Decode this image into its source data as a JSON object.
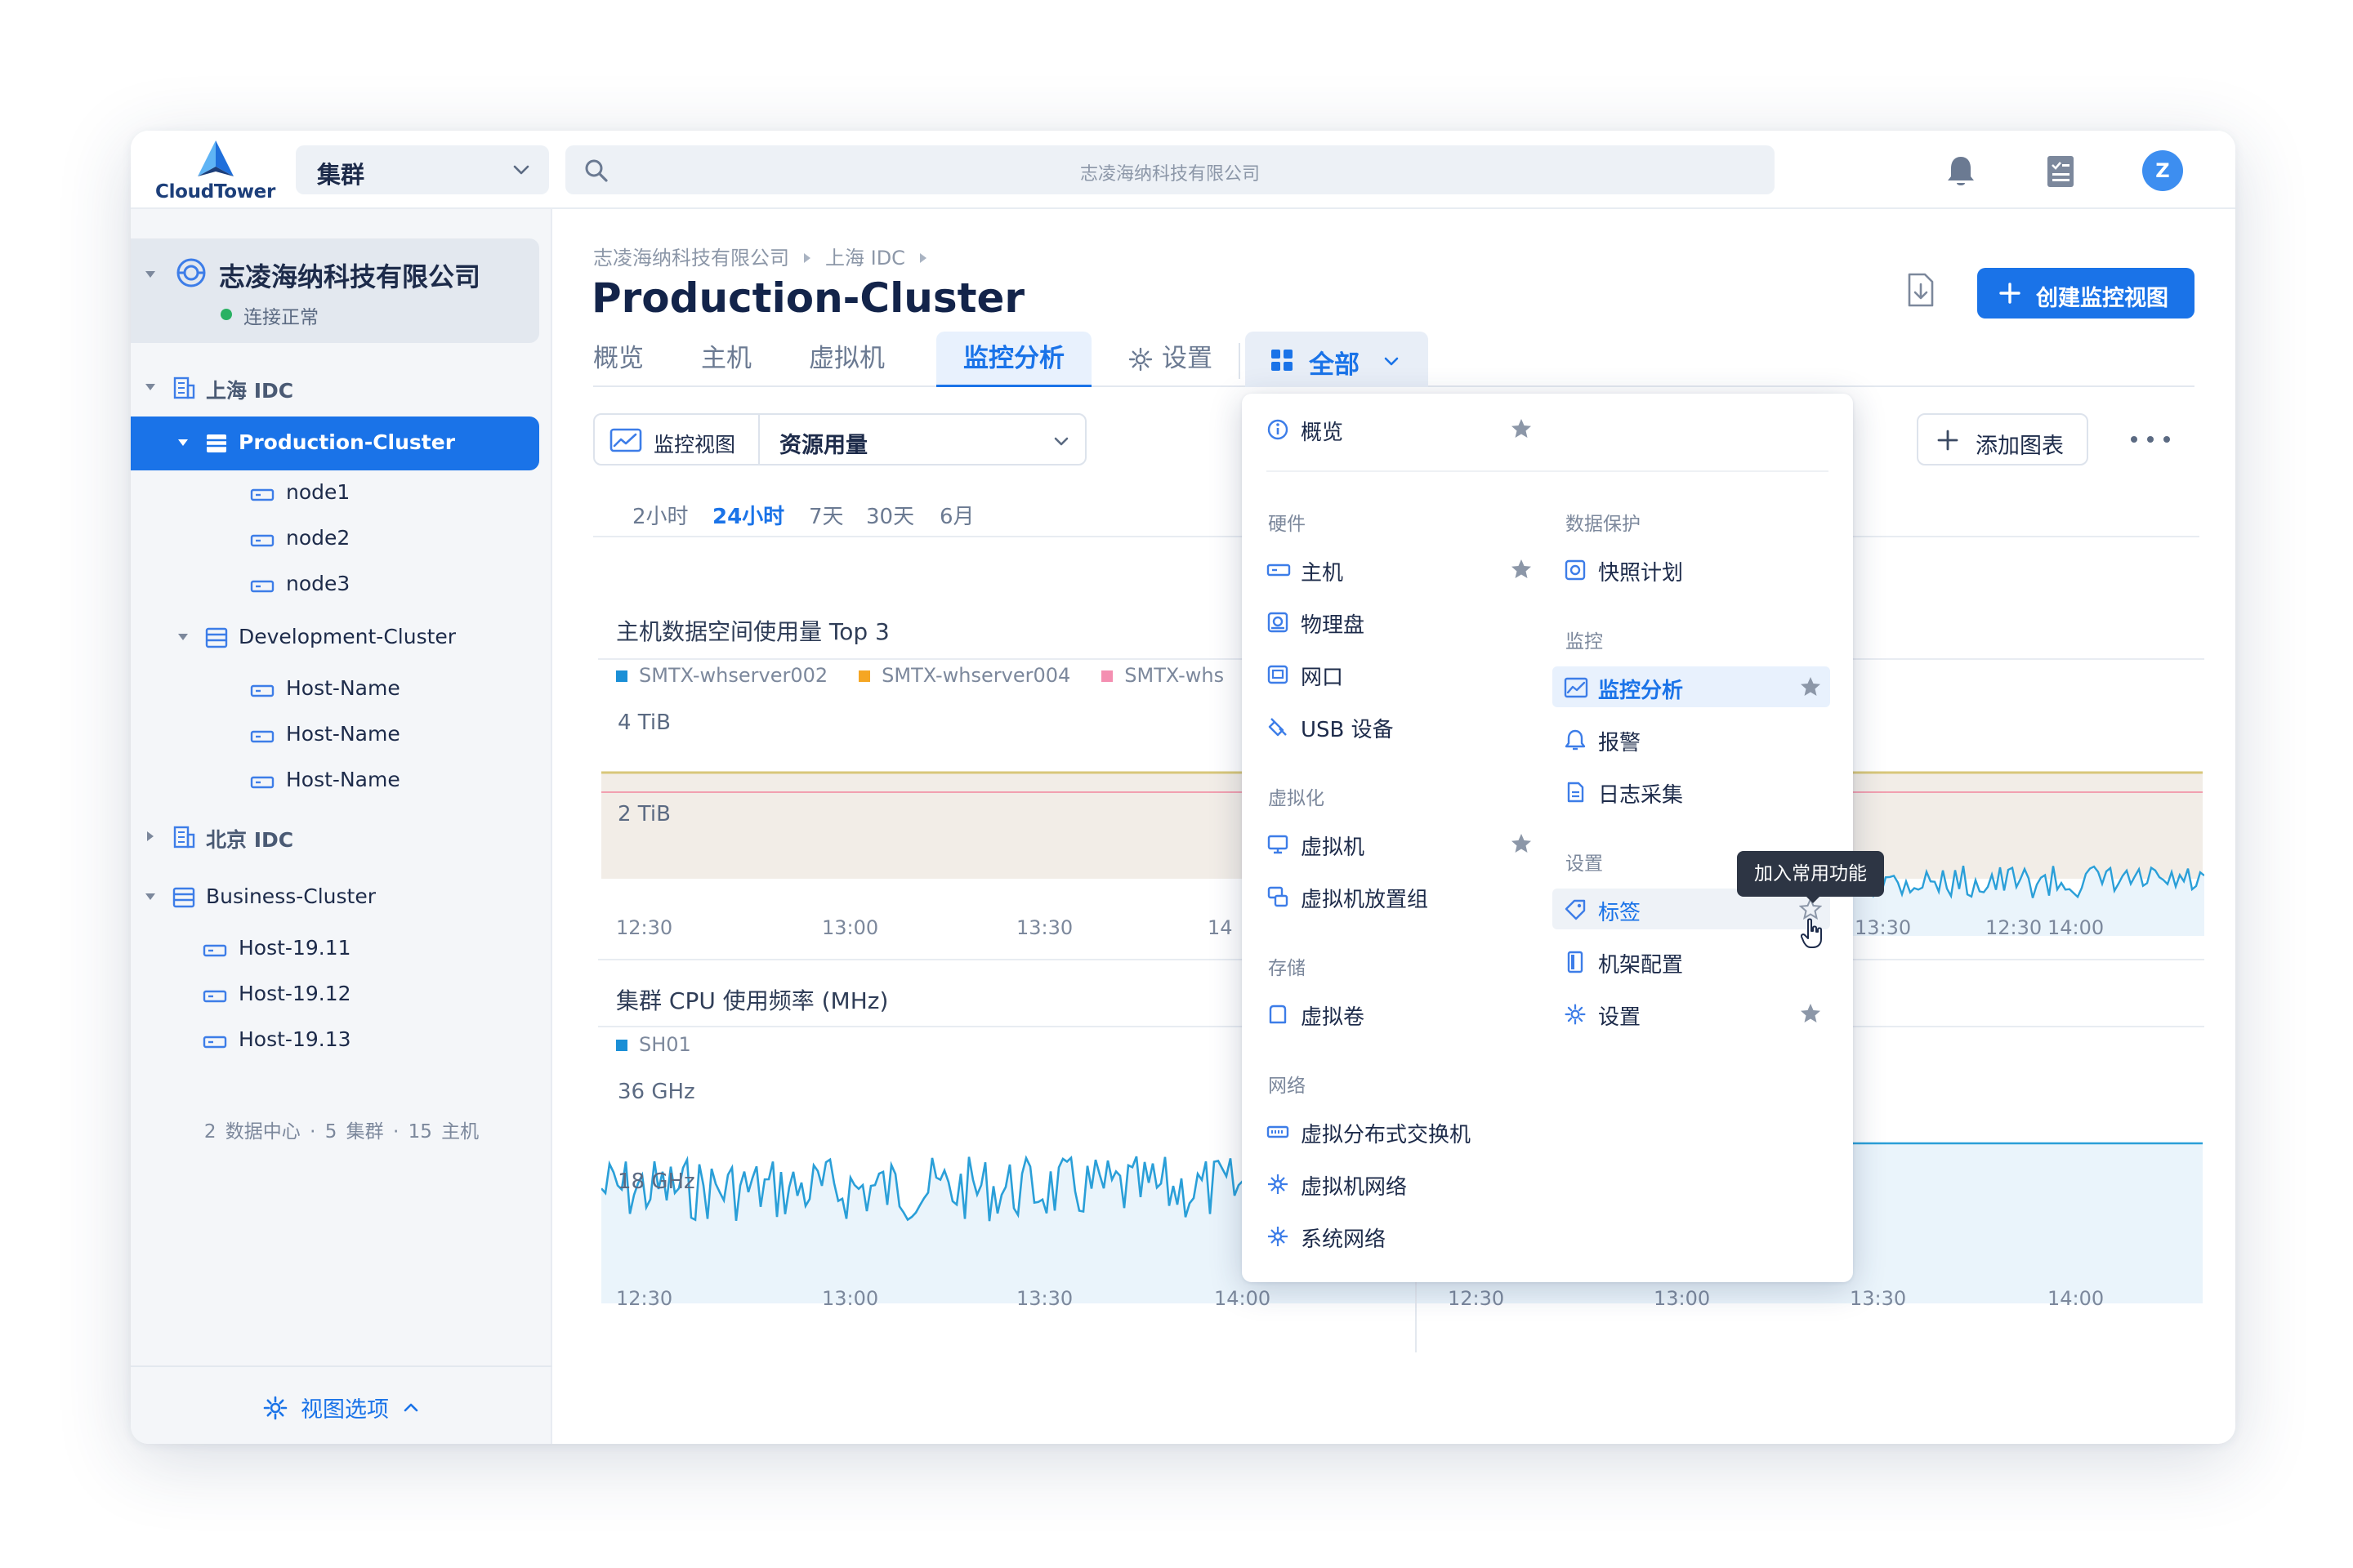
{
  "app": {
    "logo_text": "CloudTower",
    "cluster_selector": "集群",
    "search_placeholder": "志凌海纳科技有限公司",
    "user_initial": "Z"
  },
  "sidebar": {
    "org_name": "志凌海纳科技有限公司",
    "org_status": "连接正常",
    "tree": [
      {
        "label": "上海 IDC",
        "type": "datacenter"
      },
      {
        "label": "Production-Cluster",
        "type": "cluster",
        "active": true
      },
      {
        "label": "node1",
        "type": "host"
      },
      {
        "label": "node2",
        "type": "host"
      },
      {
        "label": "node3",
        "type": "host"
      },
      {
        "label": "Development-Cluster",
        "type": "cluster"
      },
      {
        "label": "Host-Name",
        "type": "host"
      },
      {
        "label": "Host-Name",
        "type": "host"
      },
      {
        "label": "Host-Name",
        "type": "host"
      },
      {
        "label": "北京 IDC",
        "type": "datacenter"
      },
      {
        "label": "Business-Cluster",
        "type": "cluster"
      },
      {
        "label": "Host-19.11",
        "type": "host"
      },
      {
        "label": "Host-19.12",
        "type": "host"
      },
      {
        "label": "Host-19.13",
        "type": "host"
      }
    ],
    "summary": "2 数据中心 · 5 集群 · 15 主机",
    "footer_label": "视图选项"
  },
  "header": {
    "breadcrumb": [
      "志凌海纳科技有限公司",
      "上海 IDC"
    ],
    "title": "Production-Cluster",
    "create_button": "创建监控视图"
  },
  "tabs": [
    {
      "label": "概览"
    },
    {
      "label": "主机"
    },
    {
      "label": "虚拟机"
    },
    {
      "label": "监控分析",
      "active": true
    },
    {
      "label": "设置"
    }
  ],
  "all_tab_label": "全部",
  "toolbar": {
    "view_label": "监控视图",
    "view_value": "资源用量",
    "add_chart": "添加图表",
    "ranges": [
      "2小时",
      "24小时",
      "7天",
      "30天",
      "6月"
    ],
    "active_range": "24小时"
  },
  "charts": {
    "storage": {
      "title": "主机数据空间使用量 Top 3",
      "legend": [
        {
          "name": "SMTX-whserver002",
          "color": "#1a8fd6"
        },
        {
          "name": "SMTX-whserver004",
          "color": "#f5a623"
        },
        {
          "name": "SMTX-whs",
          "color": "#f48fb1"
        }
      ],
      "y_labels": [
        "4 TiB",
        "2 TiB"
      ],
      "x_labels": [
        "12:30",
        "13:00",
        "13:30",
        "14",
        "12:30",
        "13:30",
        "14:00"
      ]
    },
    "cpu": {
      "title": "集群 CPU 使用频率 (MHz)",
      "legend": [
        {
          "name": "SH01",
          "color": "#1a8fd6"
        }
      ],
      "y_labels": [
        "36 GHz",
        "18 GHz"
      ],
      "x_labels": [
        "12:30",
        "13:00",
        "13:30",
        "14:00",
        "12:30",
        "13:00",
        "13:30",
        "14:00"
      ]
    }
  },
  "menu": {
    "overview": "概览",
    "sections": {
      "hardware": {
        "header": "硬件",
        "items": [
          "主机",
          "物理盘",
          "网口",
          "USB 设备"
        ]
      },
      "virtualization": {
        "header": "虚拟化",
        "items": [
          "虚拟机",
          "虚拟机放置组"
        ]
      },
      "storage": {
        "header": "存储",
        "items": [
          "虚拟卷"
        ]
      },
      "network": {
        "header": "网络",
        "items": [
          "虚拟分布式交换机",
          "虚拟机网络",
          "系统网络"
        ]
      },
      "data_protection": {
        "header": "数据保护",
        "items": [
          "快照计划"
        ]
      },
      "monitoring": {
        "header": "监控",
        "items": [
          "监控分析",
          "报警",
          "日志采集"
        ]
      },
      "settings": {
        "header": "设置",
        "items": [
          "标签",
          "机架配置",
          "设置"
        ]
      }
    },
    "tooltip": "加入常用功能"
  }
}
